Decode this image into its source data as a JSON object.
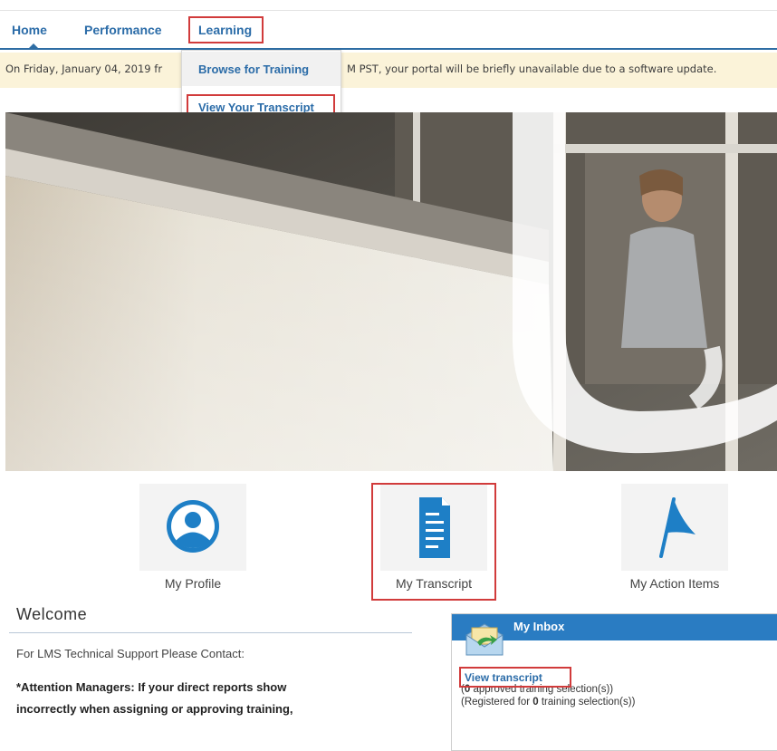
{
  "nav": {
    "home": "Home",
    "performance": "Performance",
    "learning": "Learning"
  },
  "banner": {
    "text_left": "On Friday, January 04, 2019 fr",
    "text_right": "M PST, your portal will be briefly unavailable due to a software update."
  },
  "dropdown": {
    "browse": "Browse for Training",
    "transcript": "View Your Transcript"
  },
  "tiles": {
    "profile": "My Profile",
    "transcript": "My Transcript",
    "action_items": "My Action Items"
  },
  "welcome": {
    "title": "Welcome",
    "support": "For LMS Technical Support Please Contact:",
    "attention_line1": "*Attention Managers: If your direct reports show",
    "attention_line2": "incorrectly when assigning or approving training,"
  },
  "inbox": {
    "title": "My Inbox",
    "link": "View transcript",
    "approved_count": "0",
    "approved_text": " approved training selection(s))",
    "registered_prefix": "(Registered for ",
    "registered_count": "0",
    "registered_suffix": " training selection(s))"
  },
  "colors": {
    "link_blue": "#2b6ca8",
    "highlight_red": "#d13b3b",
    "banner_bg": "#fbf3d9",
    "inbox_header": "#2a7cc2",
    "icon_blue": "#1e7fc6"
  },
  "icons": {
    "profile": "user-circle-icon",
    "transcript": "document-icon",
    "action_items": "flag-icon",
    "inbox": "envelope-icon"
  }
}
